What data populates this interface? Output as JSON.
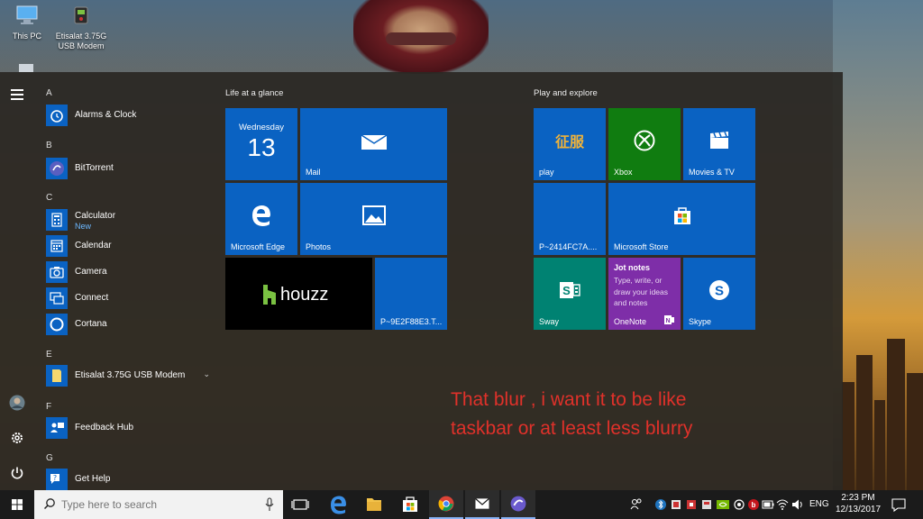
{
  "desktop": {
    "icons": [
      {
        "label": "This PC",
        "icon": "computer-icon"
      },
      {
        "label": "Etisalat 3.75G USB Modem",
        "label_line1": "Etisalat 3.75G",
        "label_line2": "USB Modem",
        "icon": "modem-icon"
      }
    ]
  },
  "start_menu": {
    "rail": [
      "menu-icon",
      "user-avatar",
      "settings-icon",
      "power-icon"
    ],
    "app_list": {
      "letters": [
        "A",
        "B",
        "C",
        "E",
        "F",
        "G"
      ],
      "apps": [
        {
          "name": "Alarms & Clock",
          "icon": "alarm-clock-icon"
        },
        {
          "name": "BitTorrent",
          "icon": "bittorrent-icon"
        },
        {
          "name": "Calculator",
          "sub": "New",
          "icon": "calculator-icon"
        },
        {
          "name": "Calendar",
          "icon": "calendar-icon"
        },
        {
          "name": "Camera",
          "icon": "camera-icon"
        },
        {
          "name": "Connect",
          "icon": "connect-icon"
        },
        {
          "name": "Cortana",
          "icon": "cortana-icon"
        },
        {
          "name": "Etisalat 3.75G USB Modem",
          "icon": "folder-icon",
          "expand": "⌄"
        },
        {
          "name": "Feedback Hub",
          "icon": "feedback-icon"
        },
        {
          "name": "Get Help",
          "icon": "help-icon"
        }
      ]
    },
    "groups": [
      {
        "title": "Life at a glance"
      },
      {
        "title": "Play and explore"
      }
    ],
    "tiles": {
      "calendar": {
        "day": "Wednesday",
        "date": "13"
      },
      "mail": "Mail",
      "edge": "Microsoft Edge",
      "photos": "Photos",
      "houzz": "houzz",
      "p9e": "P~9E2F88E3.T...",
      "play": "play",
      "play_glyph": "征服",
      "xbox": "Xbox",
      "movies": "Movies & TV",
      "p2414": "P~2414FC7A....",
      "store": "Microsoft Store",
      "sway": "Sway",
      "onenote": {
        "title": "Jot notes",
        "body": "Type, write, or draw your ideas and notes",
        "label": "OneNote"
      },
      "skype": "Skype"
    },
    "colors": {
      "tile_blue": "#0a62c2",
      "xbox_green": "#107c10",
      "onenote_purple": "#7e2ea8",
      "sway_teal": "#008272",
      "houzz_black": "#000000"
    }
  },
  "annotation": {
    "line1": "That blur , i want it to be like",
    "line2": "taskbar or at least less blurry",
    "color": "#e0312a"
  },
  "taskbar": {
    "search_placeholder": "Type here to search",
    "pinned": [
      "task-view-icon",
      "edge-icon",
      "file-explorer-icon",
      "store-icon",
      "chrome-icon",
      "mail-icon",
      "bittorrent-icon"
    ],
    "tray": {
      "language": "ENG",
      "time": "2:23 PM",
      "date": "12/13/2017"
    }
  }
}
